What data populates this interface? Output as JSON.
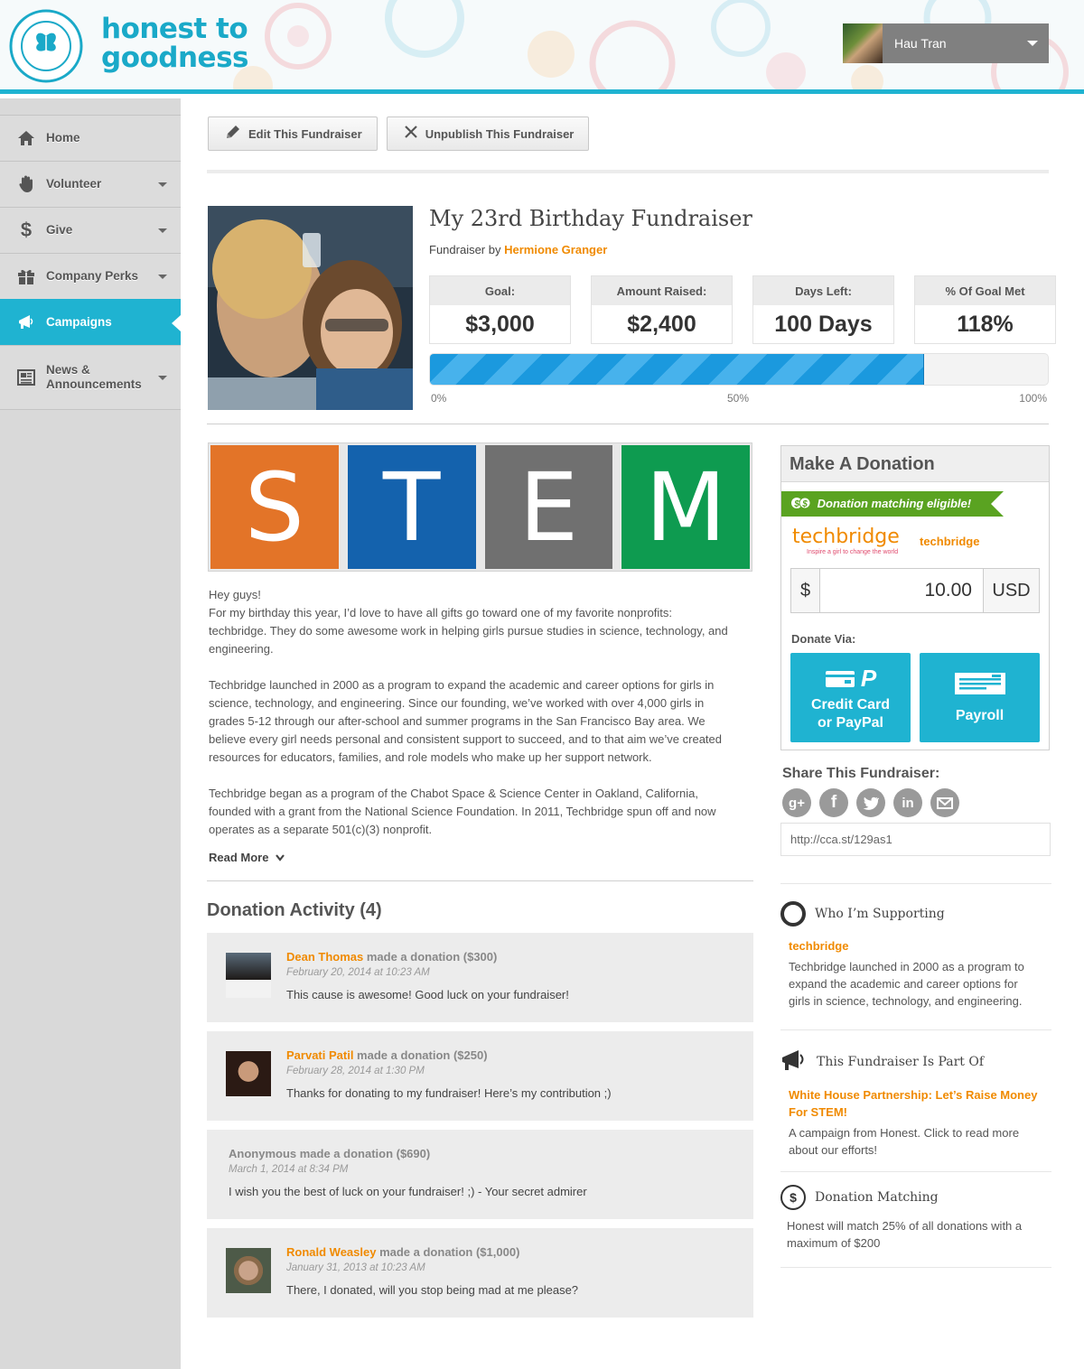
{
  "brand": {
    "line1": "honest to",
    "line2": "goodness"
  },
  "user": {
    "name": "Hau Tran"
  },
  "sidebar": {
    "items": [
      {
        "label": "Home",
        "icon": "home-icon",
        "has_caret": false
      },
      {
        "label": "Volunteer",
        "icon": "hand-icon",
        "has_caret": true
      },
      {
        "label": "Give",
        "icon": "dollar-icon",
        "has_caret": true
      },
      {
        "label": "Company Perks",
        "icon": "gift-icon",
        "has_caret": true
      },
      {
        "label": "Campaigns",
        "icon": "megaphone-icon",
        "has_caret": false,
        "active": true
      },
      {
        "label": "News &",
        "label2": "Announcements",
        "icon": "newspaper-icon",
        "has_caret": true
      }
    ]
  },
  "actions": {
    "edit": "Edit This Fundraiser",
    "unpublish": "Unpublish This Fundraiser"
  },
  "fundraiser": {
    "title": "My 23rd Birthday Fundraiser",
    "by_prefix": "Fundraiser by",
    "by_name": "Hermione Granger",
    "stats": [
      {
        "label": "Goal:",
        "value": "$3,000"
      },
      {
        "label": "Amount Raised:",
        "value": "$2,400"
      },
      {
        "label": "Days Left:",
        "value": "100 Days"
      },
      {
        "label": "% Of Goal Met",
        "value": "118%"
      }
    ],
    "progress_fraction": 0.8,
    "ticks": [
      "0%",
      "50%",
      "100%"
    ]
  },
  "stem": {
    "letters": [
      "S",
      "T",
      "E",
      "M"
    ],
    "colors": [
      "#e37428",
      "#1462ad",
      "#707070",
      "#0e9b50"
    ]
  },
  "story": {
    "p1a": "Hey guys!",
    "p1b": "For my birthday this year, I’d love to have all gifts go toward one of my favorite nonprofits: techbridge. They do some awesome work in helping girls pursue studies in science, technology, and engineering.",
    "p2": "Techbridge launched in 2000 as a program to expand the academic and career options for girls in science, technology, and engineering. Since our founding, we’ve worked with over 4,000 girls in grades 5-12 through our after-school and summer programs in the San Francisco Bay area. We believe every girl needs personal and consistent support to succeed, and to that aim we’ve created resources for educators, families, and role models who make up her support network.",
    "p3": "Techbridge began as a program of the Chabot Space & Science Center in Oakland, California, founded with a grant from the National Science Foundation. In 2011, Techbridge spun off and now operates as a separate 501(c)(3) nonprofit.",
    "read_more": "Read More"
  },
  "activity": {
    "title": "Donation Activity (4)",
    "items": [
      {
        "name": "Dean Thomas",
        "action": " made a donation ($300)",
        "date": "February 20, 2014 at 10:23 AM",
        "message": "This cause is awesome! Good luck on your fundraiser!"
      },
      {
        "name": "Parvati Patil",
        "action": " made a donation ($250)",
        "date": "February 28, 2014 at 1:30 PM",
        "message": "Thanks for donating to my fundraiser! Here’s my contribution ;)"
      },
      {
        "name": "",
        "action": "Anonymous made a donation ($690)",
        "date": "March 1, 2014 at 8:34 PM",
        "message": "I wish you the best of luck on your fundraiser! ;) - Your secret admirer"
      },
      {
        "name": "Ronald Weasley",
        "action": " made a donation ($1,000)",
        "date": "January 31, 2013 at 10:23 AM",
        "message": "There, I donated, will you stop being mad at me please?"
      }
    ]
  },
  "donate": {
    "title": "Make A Donation",
    "matching": "Donation matching eligible!",
    "org_logo": "techbridge",
    "org_tagline": "Inspire a girl to change the world",
    "org_name": "techbridge",
    "currency_symbol": "$",
    "amount": "10.00",
    "currency": "USD",
    "via_label": "Donate Via:",
    "card_line1": "Credit Card",
    "card_line2": "or PayPal",
    "payroll": "Payroll"
  },
  "share": {
    "title": "Share This Fundraiser:",
    "networks": [
      "googleplus-icon",
      "facebook-icon",
      "twitter-icon",
      "linkedin-icon",
      "email-icon"
    ],
    "url": "http://cca.st/129as1"
  },
  "supporting": {
    "title": "Who I’m Supporting",
    "org": "techbridge",
    "text": "Techbridge launched in 2000 as a program to expand the academic and career options for girls in science, technology, and engineering."
  },
  "part_of": {
    "title": "This Fundraiser Is Part Of",
    "link": "White House Partnership: Let’s Raise Money For STEM!",
    "text": "A campaign from Honest. Click to read more about our efforts!"
  },
  "matching": {
    "title": "Donation Matching",
    "text": "Honest will match 25% of all donations with a maximum of $200"
  },
  "colors": {
    "accent": "#1fb3d1",
    "orange": "#f08a00",
    "green": "#5aa321",
    "progress": "#1b99de"
  }
}
